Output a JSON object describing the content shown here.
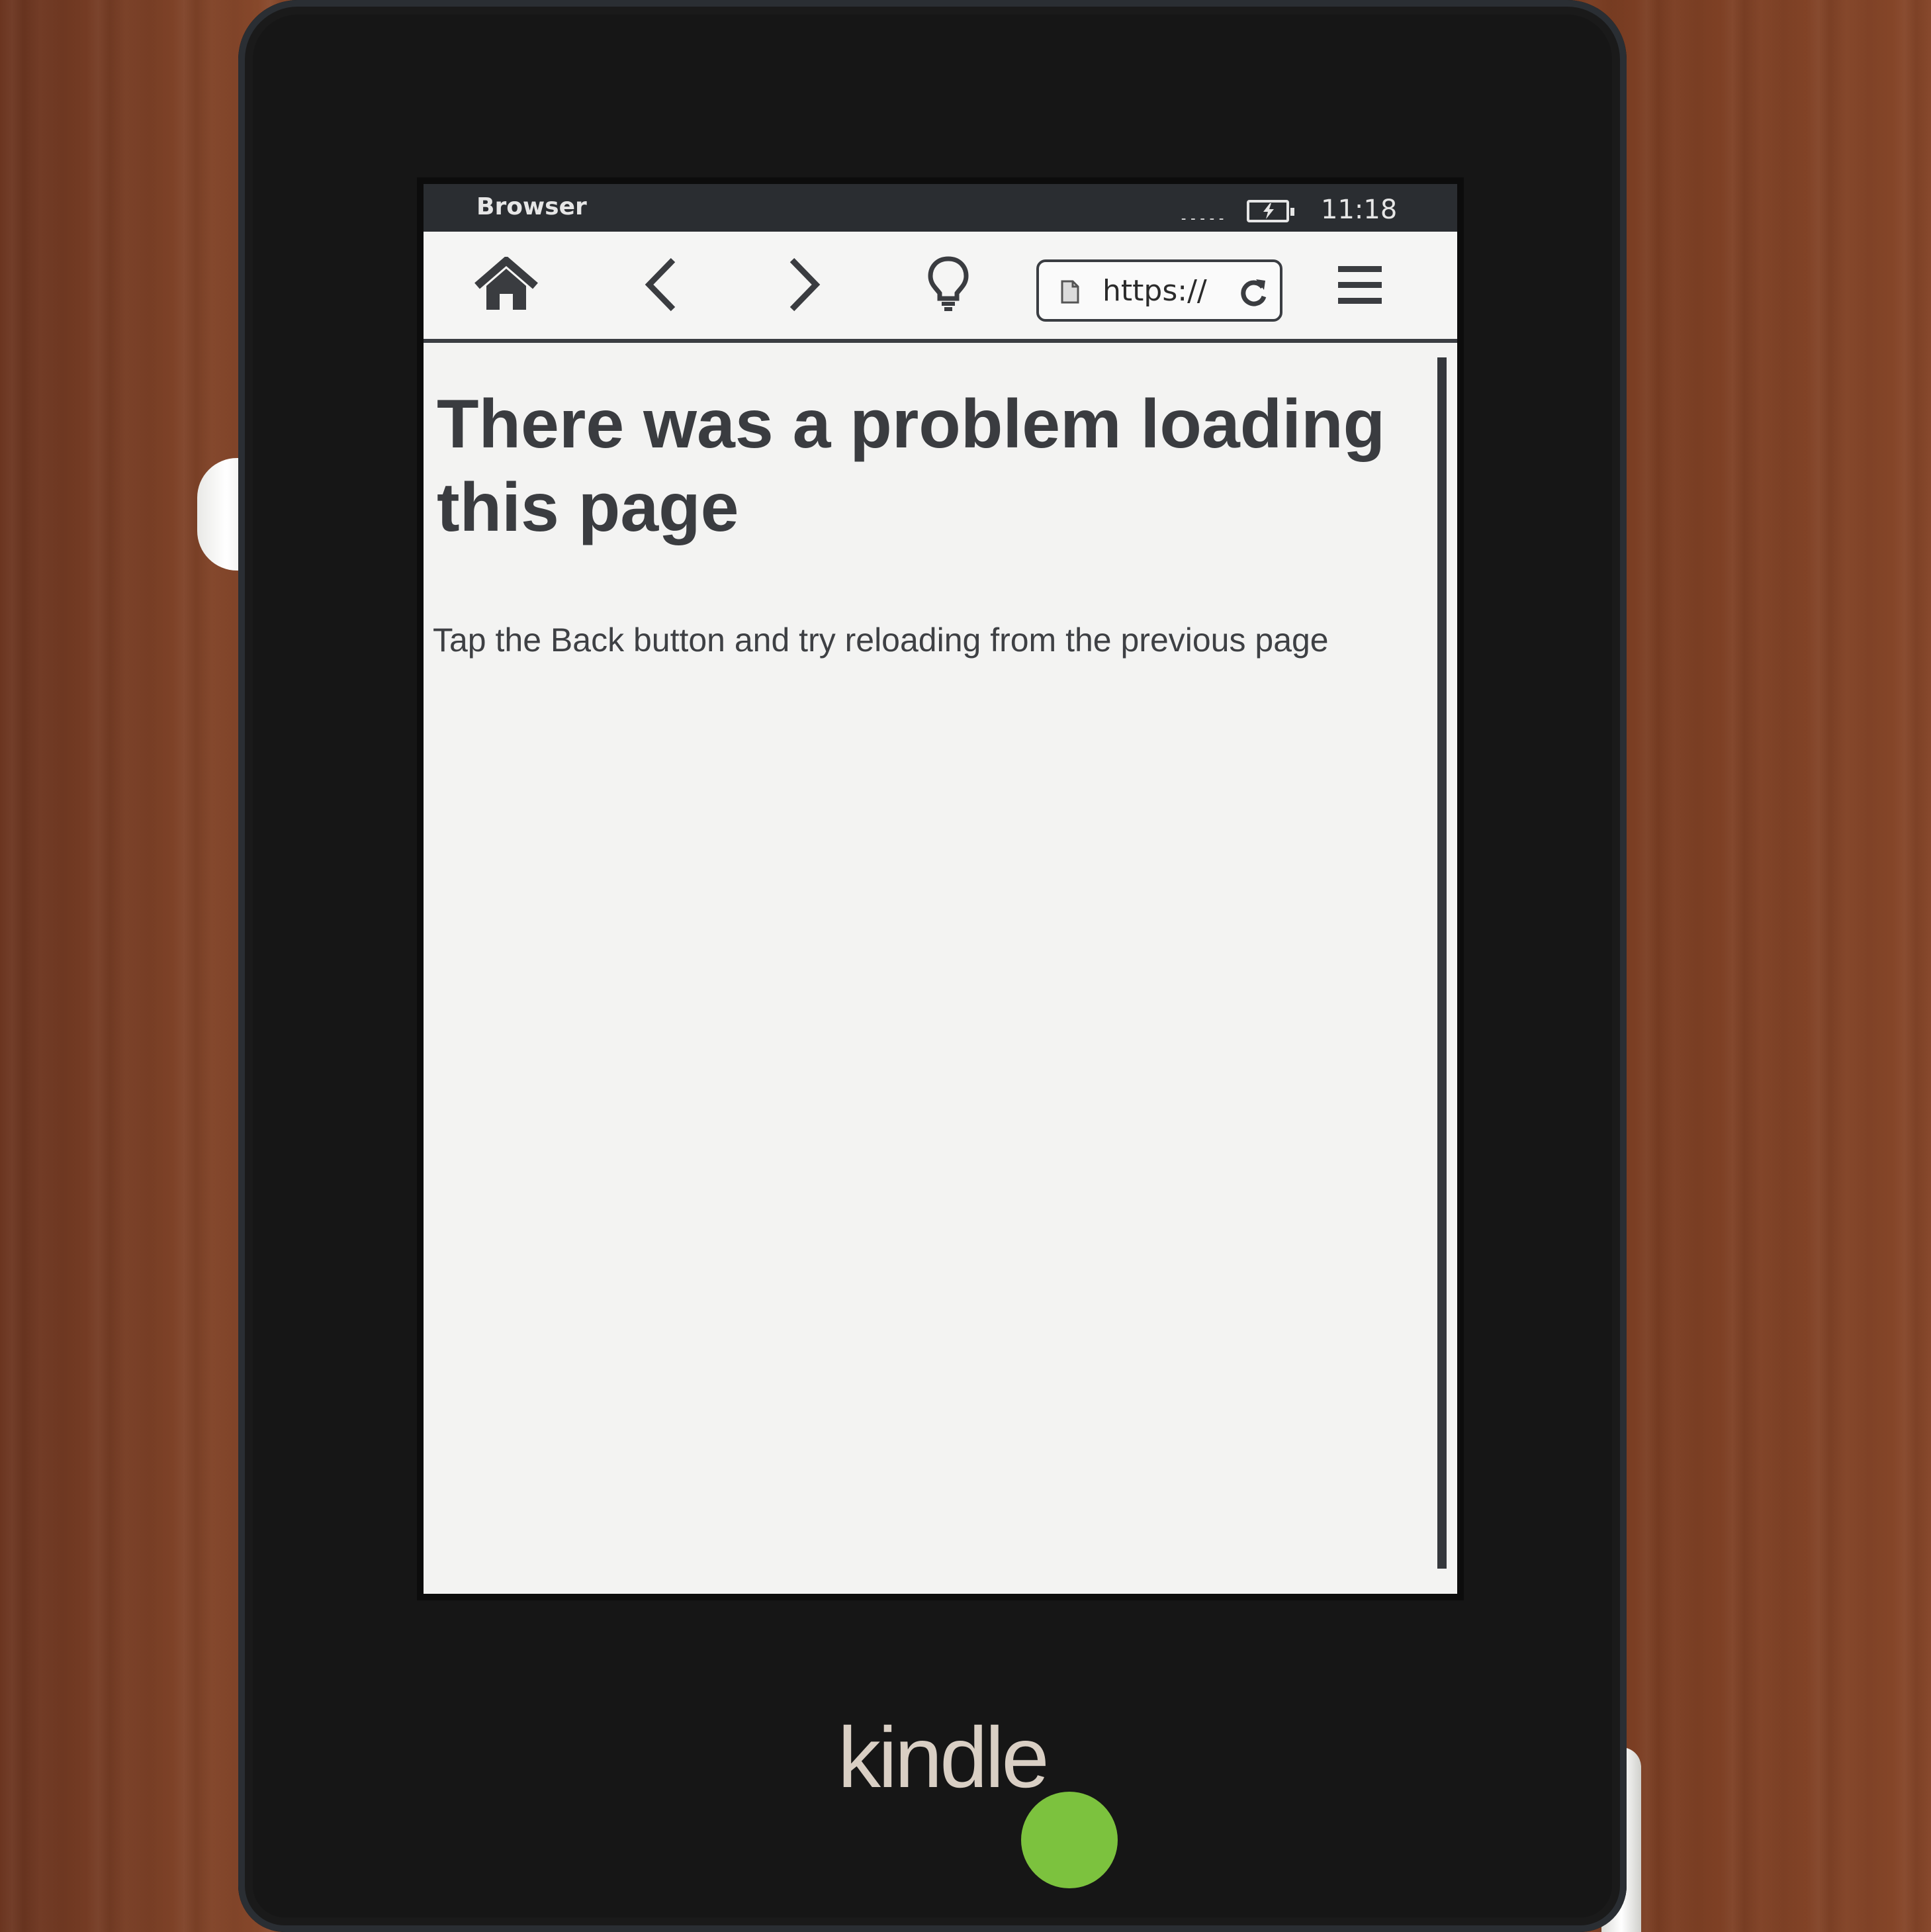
{
  "statusbar": {
    "app_title": "Browser",
    "signal_indicator": "-----",
    "battery_icon": "battery-charging-icon",
    "time": "11:18"
  },
  "toolbar": {
    "home_icon": "home-icon",
    "back_icon": "chevron-left-icon",
    "forward_icon": "chevron-right-icon",
    "light_icon": "lightbulb-icon",
    "url_text": "https://",
    "reload_icon": "reload-icon",
    "menu_icon": "hamburger-menu-icon"
  },
  "page": {
    "error_title": "There was a problem loading this page",
    "error_message": "Tap the Back button and try reloading from the previous page"
  },
  "device": {
    "logo": "kindle"
  },
  "colors": {
    "screen_bg": "#f3f3f2",
    "statusbar_bg": "#2a2d31",
    "bezel": "#161616",
    "indicator_dot": "#7cc23e"
  }
}
